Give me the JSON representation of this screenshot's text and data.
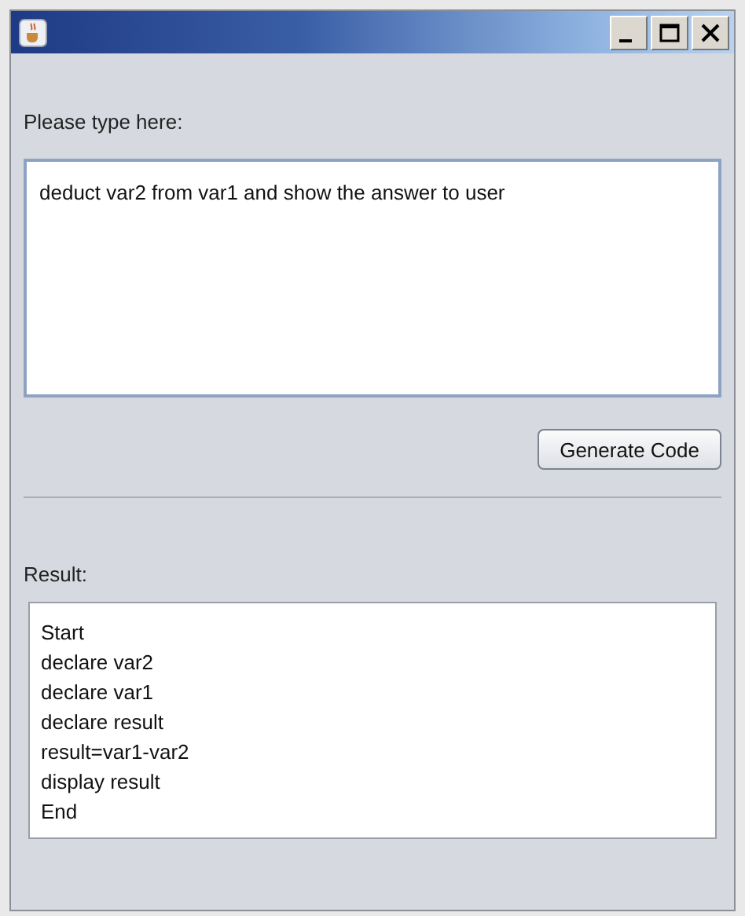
{
  "prompt_label": "Please type here:",
  "input": {
    "value": "deduct var2 from var1 and show the answer to user"
  },
  "generate_button": "Generate Code",
  "result_label": "Result:",
  "result_lines": [
    "Start",
    "declare var2",
    "declare var1",
    "declare result",
    "result=var1-var2",
    "display result",
    "End"
  ]
}
